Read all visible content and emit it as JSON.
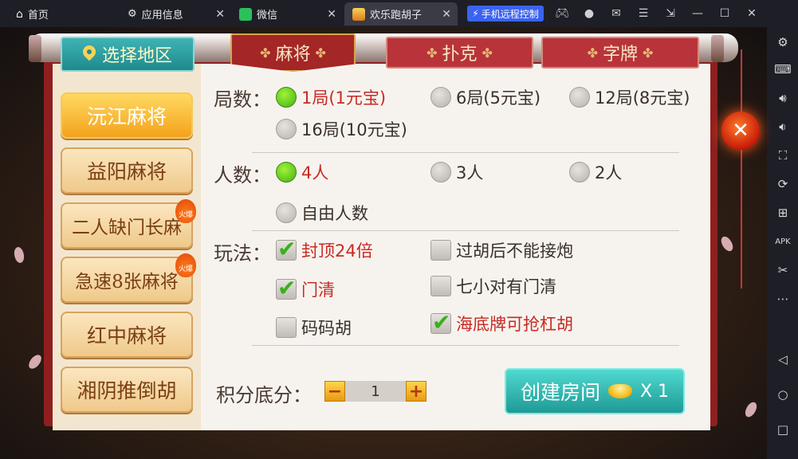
{
  "tabs": [
    {
      "label": "首页",
      "icon": "home-icon"
    },
    {
      "label": "应用信息",
      "icon": "gear-icon"
    },
    {
      "label": "微信",
      "icon": "wechat-icon"
    },
    {
      "label": "欢乐跑胡子",
      "icon": "game-app-icon"
    }
  ],
  "remote_control": {
    "label": "手机远程控制"
  },
  "game": {
    "region_tab": "选择地区",
    "game_tabs": [
      "麻将",
      "扑克",
      "字牌"
    ],
    "regions": [
      "沅江麻将",
      "益阳麻将",
      "二人缺门长麻",
      "急速8张麻将",
      "红中麻将",
      "湘阴推倒胡"
    ],
    "hot_badge": "火爆",
    "rounds": {
      "label": "局数：",
      "options": [
        "1局(1元宝)",
        "6局(5元宝)",
        "12局(8元宝)",
        "16局(10元宝)"
      ]
    },
    "players": {
      "label": "人数：",
      "options": [
        "4人",
        "3人",
        "2人",
        "自由人数"
      ]
    },
    "rules": {
      "label": "玩法：",
      "options": [
        "封顶24倍",
        "过胡后不能接炮",
        "门清",
        "七小对有门清",
        "码码胡",
        "海底牌可抢杠胡"
      ]
    },
    "score": {
      "label": "积分底分：",
      "value": "1",
      "minus": "−",
      "plus": "+"
    },
    "create": {
      "label": "创建房间",
      "count": "X 1"
    },
    "close": "✕"
  },
  "colors": {
    "accent_selected": "#c82a22",
    "teal_button": "#1f9a96",
    "frame_red": "#8f1f1f"
  }
}
